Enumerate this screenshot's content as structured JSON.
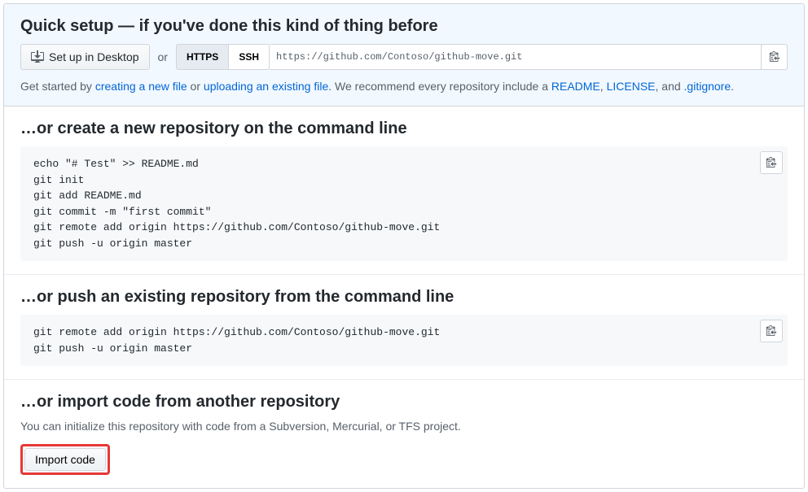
{
  "quick_setup": {
    "heading": "Quick setup — if you've done this kind of thing before",
    "desktop_button": "Set up in Desktop",
    "or_text": "or",
    "protocol_https": "HTTPS",
    "protocol_ssh": "SSH",
    "clone_url": "https://github.com/Contoso/github-move.git",
    "help_prefix": "Get started by ",
    "link_create_file": "creating a new file",
    "help_or": " or ",
    "link_upload_file": "uploading an existing file",
    "help_mid": ". We recommend every repository include a ",
    "link_readme": "README",
    "help_comma1": ", ",
    "link_license": "LICENSE",
    "help_comma2": ", and ",
    "link_gitignore": ".gitignore",
    "help_period": "."
  },
  "create_section": {
    "heading": "…or create a new repository on the command line",
    "code": "echo \"# Test\" >> README.md\ngit init\ngit add README.md\ngit commit -m \"first commit\"\ngit remote add origin https://github.com/Contoso/github-move.git\ngit push -u origin master"
  },
  "push_section": {
    "heading": "…or push an existing repository from the command line",
    "code": "git remote add origin https://github.com/Contoso/github-move.git\ngit push -u origin master"
  },
  "import_section": {
    "heading": "…or import code from another repository",
    "description": "You can initialize this repository with code from a Subversion, Mercurial, or TFS project.",
    "button": "Import code"
  }
}
